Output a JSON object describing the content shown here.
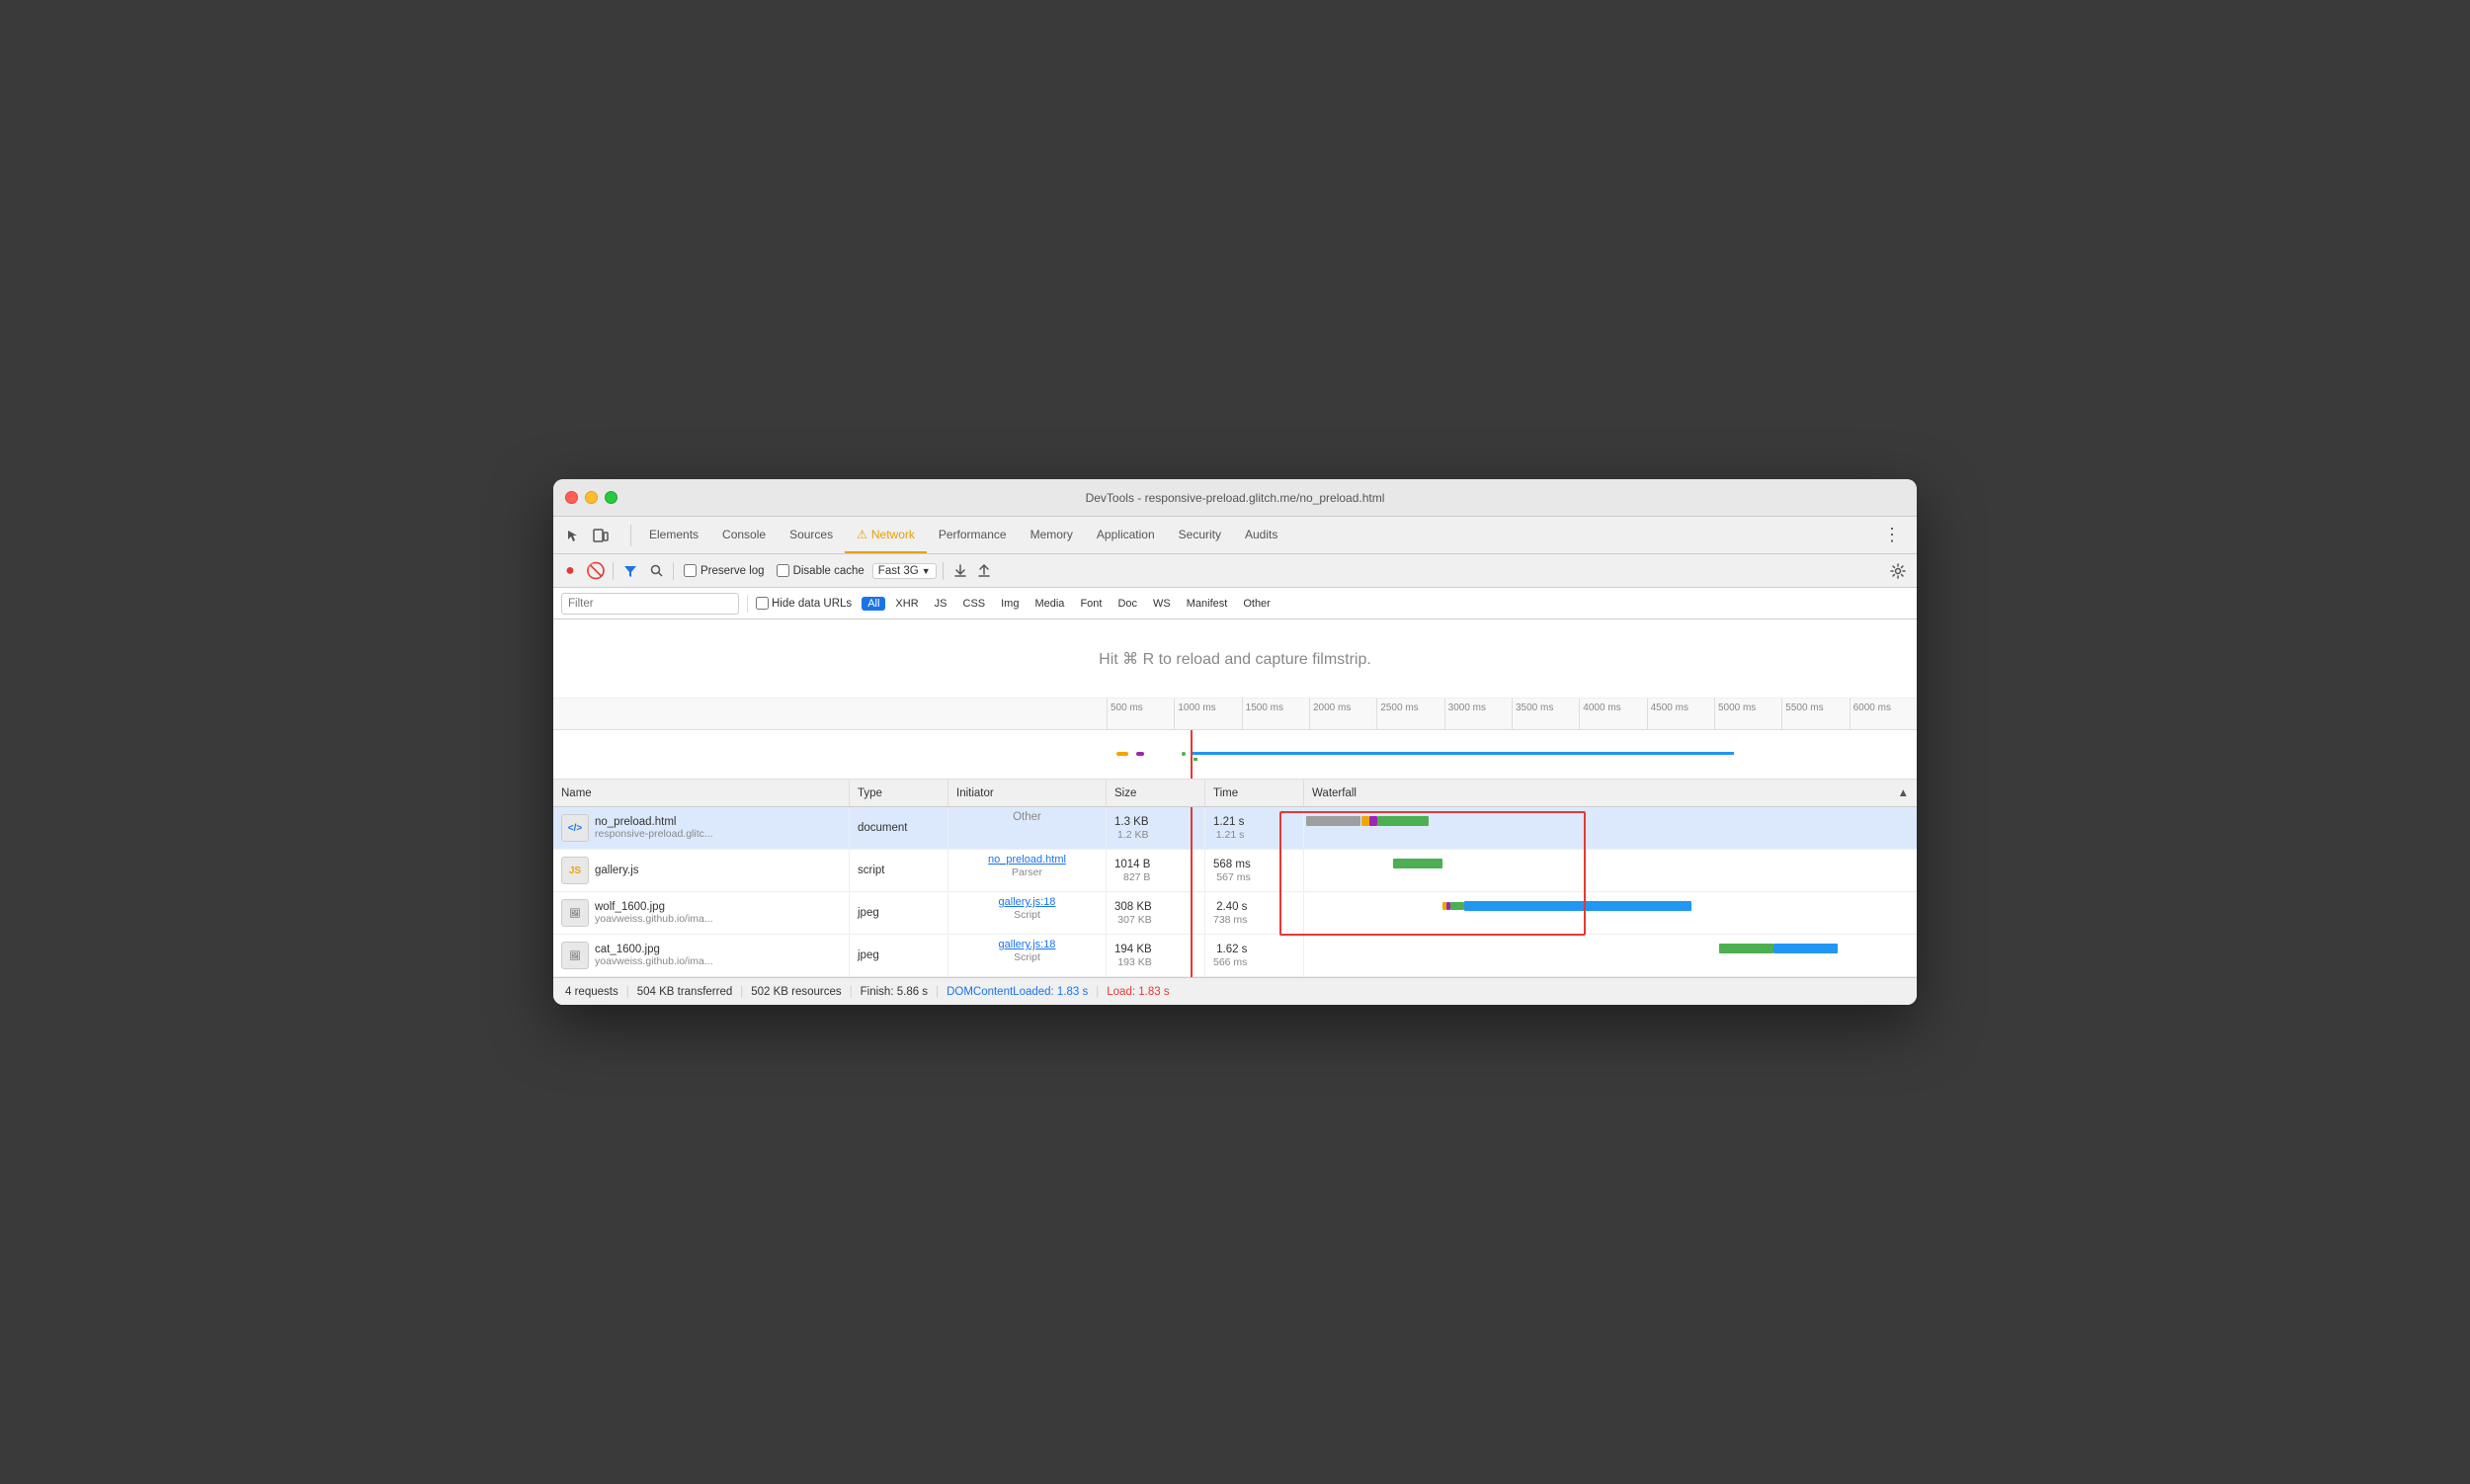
{
  "window": {
    "title": "DevTools - responsive-preload.glitch.me/no_preload.html"
  },
  "tabs": [
    {
      "id": "elements",
      "label": "Elements",
      "active": false
    },
    {
      "id": "console",
      "label": "Console",
      "active": false
    },
    {
      "id": "sources",
      "label": "Sources",
      "active": false
    },
    {
      "id": "network",
      "label": "Network",
      "active": true,
      "warning": true
    },
    {
      "id": "performance",
      "label": "Performance",
      "active": false
    },
    {
      "id": "memory",
      "label": "Memory",
      "active": false
    },
    {
      "id": "application",
      "label": "Application",
      "active": false
    },
    {
      "id": "security",
      "label": "Security",
      "active": false
    },
    {
      "id": "audits",
      "label": "Audits",
      "active": false
    }
  ],
  "toolbar": {
    "preserve_log_label": "Preserve log",
    "disable_cache_label": "Disable cache",
    "throttle_label": "Fast 3G"
  },
  "filter": {
    "placeholder": "Filter",
    "hide_data_urls_label": "Hide data URLs",
    "types": [
      "All",
      "XHR",
      "JS",
      "CSS",
      "Img",
      "Media",
      "Font",
      "Doc",
      "WS",
      "Manifest",
      "Other"
    ]
  },
  "filmstrip": {
    "hint": "Hit ⌘ R to reload and capture filmstrip."
  },
  "timeline": {
    "ticks": [
      "500 ms",
      "1000 ms",
      "1500 ms",
      "2000 ms",
      "2500 ms",
      "3000 ms",
      "3500 ms",
      "4000 ms",
      "4500 ms",
      "5000 ms",
      "5500 ms",
      "6000 ms"
    ]
  },
  "table": {
    "columns": [
      "Name",
      "Type",
      "Initiator",
      "Size",
      "Time",
      "Waterfall"
    ],
    "rows": [
      {
        "name": "no_preload.html",
        "url": "responsive-preload.glitc...",
        "type": "document",
        "initiator_link": null,
        "initiator_type": "Other",
        "size": "1.3 KB",
        "size2": "1.2 KB",
        "time": "1.21 s",
        "time2": "1.21 s",
        "selected": true
      },
      {
        "name": "gallery.js",
        "url": "",
        "type": "script",
        "initiator_link": "no_preload.html",
        "initiator_type": "Parser",
        "size": "1014 B",
        "size2": "827 B",
        "time": "568 ms",
        "time2": "567 ms",
        "selected": false
      },
      {
        "name": "wolf_1600.jpg",
        "url": "yoavweiss.github.io/ima...",
        "type": "jpeg",
        "initiator_link": "gallery.js:18",
        "initiator_type": "Script",
        "size": "308 KB",
        "size2": "307 KB",
        "time": "2.40 s",
        "time2": "738 ms",
        "selected": false
      },
      {
        "name": "cat_1600.jpg",
        "url": "yoavweiss.github.io/ima...",
        "type": "jpeg",
        "initiator_link": "gallery.js:18",
        "initiator_type": "Script",
        "size": "194 KB",
        "size2": "193 KB",
        "time": "1.62 s",
        "time2": "566 ms",
        "selected": false
      }
    ]
  },
  "status": {
    "requests": "4 requests",
    "transferred": "504 KB transferred",
    "resources": "502 KB resources",
    "finish": "Finish: 5.86 s",
    "dom_content_loaded": "DOMContentLoaded: 1.83 s",
    "load": "Load: 1.83 s"
  }
}
